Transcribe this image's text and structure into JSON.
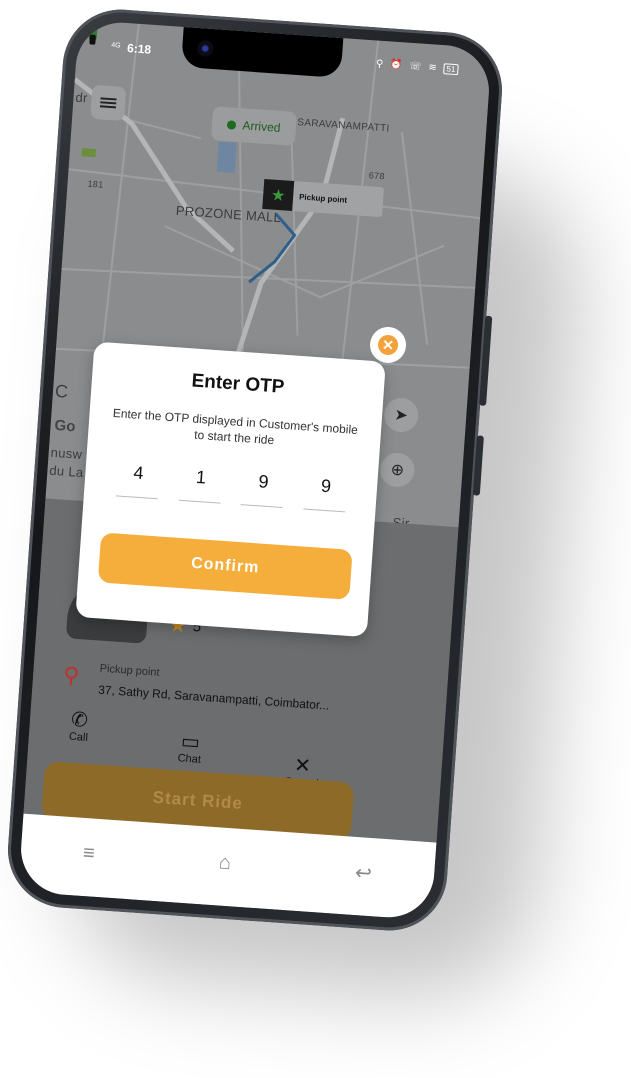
{
  "status_bar": {
    "network": "4G",
    "time": "6:18",
    "icons": "⚲ ⏰ ☏ ≋",
    "battery": "51"
  },
  "map": {
    "labels": {
      "area": "SARAVANAMPATTI",
      "mall": "PROZONE MALL",
      "road_1": "678",
      "road_2": "181",
      "left_1": "dr",
      "left_2": "C",
      "left_3": "Go",
      "left_4": "nusw",
      "left_5": "du La",
      "right_1": "Sir"
    },
    "arrived_label": "Arrived",
    "pickup_chip_label": "Pickup point"
  },
  "otp_dialog": {
    "title": "Enter OTP",
    "subtitle": "Enter the OTP displayed in Customer's mobile to start the ride",
    "digits": [
      "4",
      "1",
      "9",
      "9"
    ],
    "confirm_label": "Confirm"
  },
  "sheet": {
    "rating": "5",
    "pickup_title": "Pickup point",
    "pickup_address": "37, Sathy Rd, Saravanampatti, Coimbator...",
    "actions": {
      "call": "Call",
      "chat": "Chat",
      "cancel": "Cancel"
    },
    "start_ride_label": "Start Ride"
  },
  "colors": {
    "accent": "#f5ad3c",
    "arrived_green": "#1e6b1e",
    "pin_red": "#c2302a"
  }
}
